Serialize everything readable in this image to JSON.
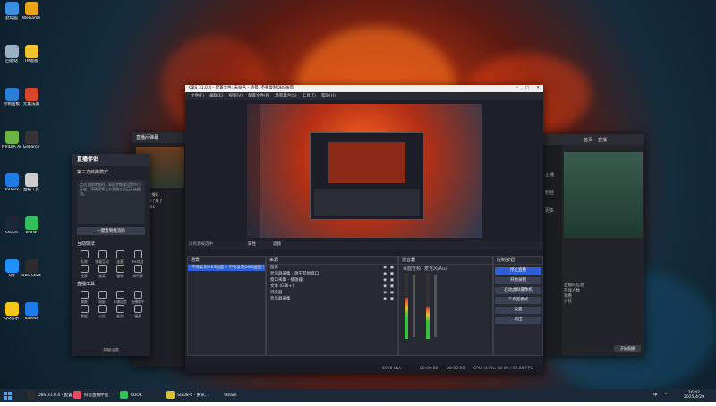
{
  "desktop_icons": [
    {
      "label": "此电脑",
      "color": "#3b8ee0"
    },
    {
      "label": "WeGame",
      "color": "#e8a31a"
    },
    {
      "label": "回收站",
      "color": "#9ab0c4"
    },
    {
      "label": "TM客服",
      "color": "#f2c230"
    },
    {
      "label": "控制面板",
      "color": "#2a7fd4"
    },
    {
      "label": "元素法典",
      "color": "#d9472b"
    },
    {
      "label": "NVIDIA App",
      "color": "#6db33f"
    },
    {
      "label": "GeForce",
      "color": "#333"
    },
    {
      "label": "ToDesk",
      "color": "#1f7be6"
    },
    {
      "label": "直播工具",
      "color": "#ccc"
    },
    {
      "label": "Steam",
      "color": "#1b2838"
    },
    {
      "label": "KOOK",
      "color": "#33c05b"
    },
    {
      "label": "QQ",
      "color": "#1e90ff"
    },
    {
      "label": "OBS Studio",
      "color": "#2c2c2c"
    },
    {
      "label": "QQ音乐",
      "color": "#f5c518"
    },
    {
      "label": "ToDesk",
      "color": "#1f7be6"
    }
  ],
  "helper_window": {
    "title": "直播伴侣",
    "subtitle": "第三方转推模式",
    "body_text": "点击立即转推时，如同步推送设置中已开启，请确保第三方直播工具已开始推流。",
    "copy_button": "一键复制推流码",
    "section_interaction": "互动玩法",
    "section_tools": "直播工具",
    "interaction_items": [
      "礼物",
      "弹幕互动",
      "连麦",
      "PK对战",
      "投票",
      "抽奖",
      "福袋",
      "排行榜"
    ],
    "tool_items": [
      "美颜",
      "贴纸",
      "开播设置",
      "直播助手",
      "数据",
      "公告",
      "任务",
      "更多"
    ],
    "footer": "开播设置"
  },
  "chat_panel": {
    "title": "直播间弹幕",
    "items": [
      "用户A: 主播好",
      "用户B: 来了来了",
      "用户C: 666"
    ]
  },
  "obs": {
    "title": "OBS 31.0.4 - 配置文件: 未命名 - 场景: 不要复制OBS画面!",
    "window_buttons": [
      "─",
      "□",
      "✕"
    ],
    "menu": [
      "文件(F)",
      "编辑(E)",
      "视图(V)",
      "配置文件(P)",
      "场景集合(S)",
      "工具(T)",
      "帮助(H)"
    ],
    "toolbar_left": "没有源被选中",
    "properties": "属性",
    "filters": "滤镜",
    "scenes_header": "场景",
    "scenes": [
      "不要复制OBS画面!! 不要复制OBS画面!!"
    ],
    "sources_header": "来源",
    "sources": [
      "图像",
      "显示器采集 - 源于其他窗口",
      "窗口采集 - 播放器",
      "文本 (GDI+)",
      "浏览器",
      "显示器采集"
    ],
    "mixer_header": "混音器",
    "mixer_channels": [
      "桌面音频",
      "麦克风/Aux"
    ],
    "mixer_levels": [
      0.62,
      0.48
    ],
    "controls_header": "控制按钮",
    "controls": [
      "停止直播",
      "开始录制",
      "启动虚拟摄像机",
      "工作室模式",
      "设置",
      "退出"
    ],
    "status": {
      "bitrate": "6000 kb/s",
      "rec": "00:00:00",
      "live": "00:00:00",
      "cpu": "CPU: 0.0%, 60.00 / 60.00 FPS"
    }
  },
  "right_app": {
    "header_tabs": [
      "首页",
      "直播"
    ],
    "side_labels": [
      "主播",
      "粉丝",
      "更多"
    ],
    "info_title": "直播间信息",
    "info_lines": [
      "在线人数",
      "观看",
      "点赞"
    ],
    "button": "开始直播"
  },
  "taskbar": {
    "items": [
      {
        "label": "OBS 31.0.4 - 配置...",
        "color": "#2c2c2c"
      },
      {
        "label": "抖音直播伴侣",
        "color": "#e84a5f"
      },
      {
        "label": "KOOK",
        "color": "#33c05b"
      },
      {
        "label": "SGO8-6 - 腾讯...",
        "color": "#d6c332"
      },
      {
        "label": "Steam",
        "color": "#1b2838"
      }
    ],
    "tray": [
      "中",
      "⌃"
    ],
    "time": "16:42",
    "date": "2025/4/29"
  },
  "colors": {
    "accent_blue": "#2f5fd6",
    "obs_bg": "#1e1f29",
    "obs_panel": "#272a33",
    "wall_orange": "#ff5a1a"
  }
}
